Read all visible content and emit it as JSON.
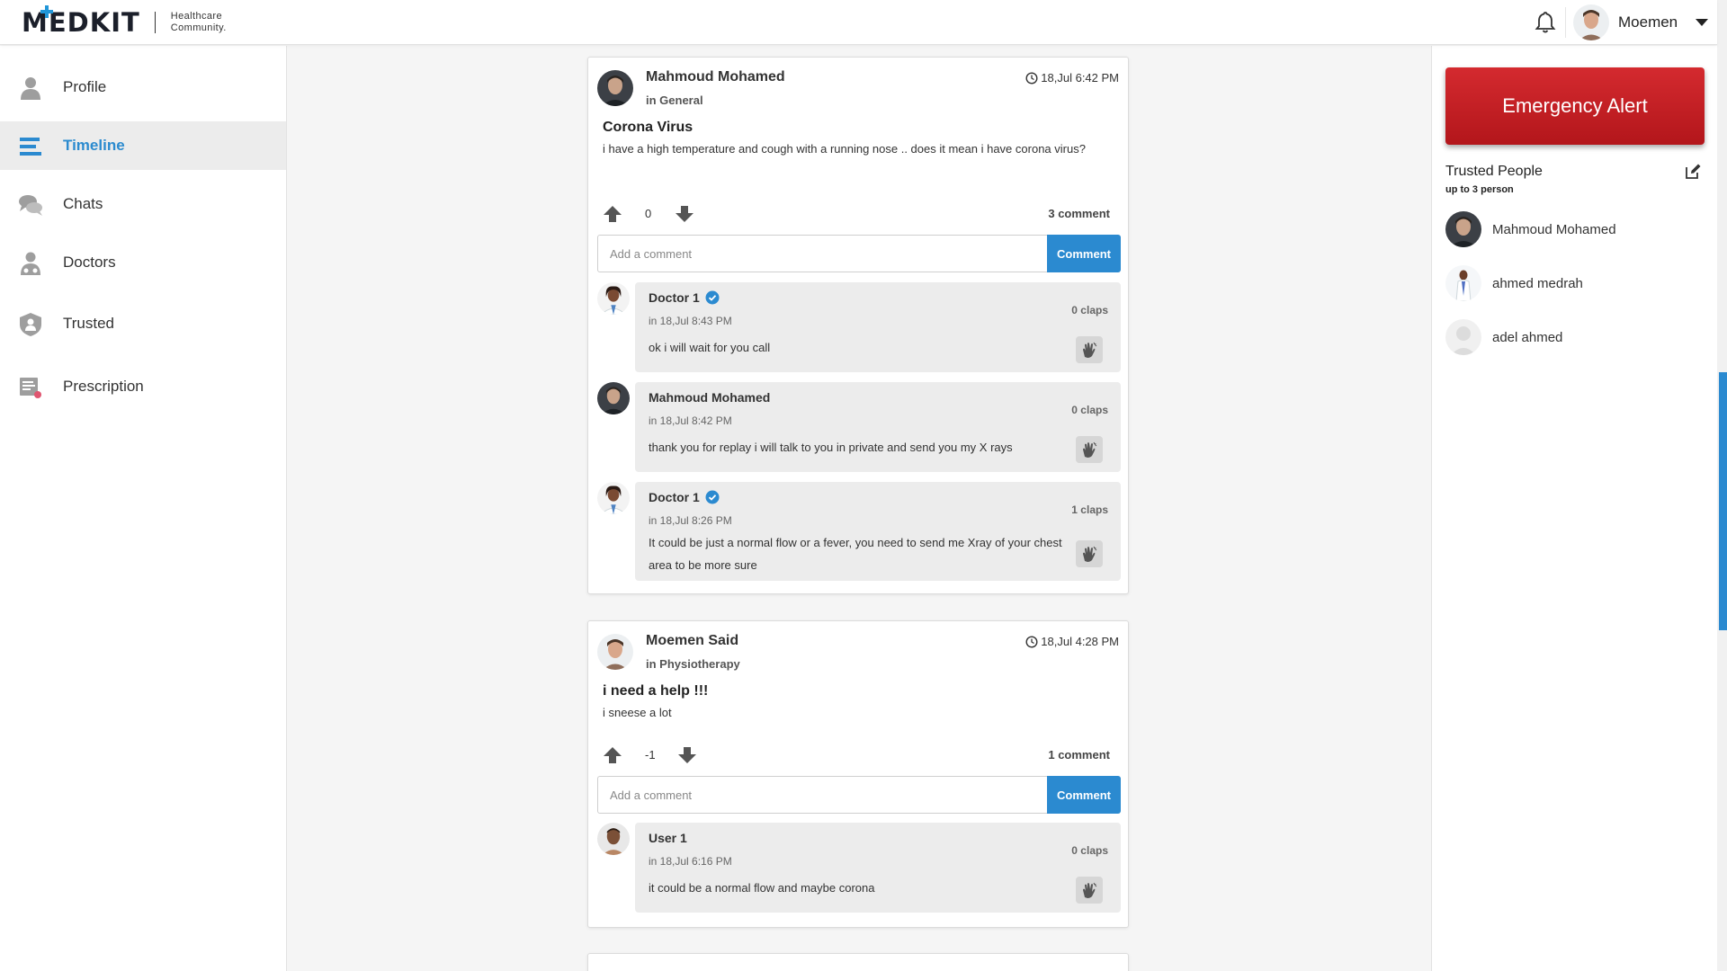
{
  "app": {
    "logo_text": "MEDKIT",
    "tagline_line1": "Healthcare",
    "tagline_line2": "Community."
  },
  "header": {
    "user_name": "Moemen"
  },
  "sidebar": {
    "items": [
      {
        "label": "Profile",
        "icon": "user-icon"
      },
      {
        "label": "Timeline",
        "icon": "timeline-icon",
        "active": true
      },
      {
        "label": "Chats",
        "icon": "chat-icon"
      },
      {
        "label": "Doctors",
        "icon": "doctor-icon"
      },
      {
        "label": "Trusted",
        "icon": "shield-icon"
      },
      {
        "label": "Prescription",
        "icon": "prescription-icon"
      }
    ]
  },
  "posts": [
    {
      "author": "Mahmoud Mohamed",
      "category": "in General",
      "time": "18,Jul 6:42 PM",
      "title": "Corona Virus",
      "body": "i have a high temperature and cough with a running nose .. does it mean i have corona virus?",
      "votes": "0",
      "comment_count": "3 comment",
      "comment_placeholder": "Add a comment",
      "comment_button": "Comment",
      "comments": [
        {
          "author": "Doctor 1",
          "verified": true,
          "date": "in 18,Jul 8:43 PM",
          "text": "ok i will wait for you call",
          "claps": "0 claps"
        },
        {
          "author": "Mahmoud Mohamed",
          "verified": false,
          "date": "in 18,Jul 8:42 PM",
          "text": "thank you for replay i will talk to you in private and send you my X rays",
          "claps": "0 claps"
        },
        {
          "author": "Doctor 1",
          "verified": true,
          "date": "in 18,Jul 8:26 PM",
          "text": "It could be just a normal flow or a fever, you need to send me Xray of your chest area to be more sure",
          "claps": "1 claps"
        }
      ]
    },
    {
      "author": "Moemen Said",
      "category": "in Physiotherapy",
      "time": "18,Jul 4:28 PM",
      "title": "i need a help !!!",
      "body": "i sneese a lot",
      "votes": "-1",
      "comment_count": "1 comment",
      "comment_placeholder": "Add a comment",
      "comment_button": "Comment",
      "comments": [
        {
          "author": "User 1",
          "verified": false,
          "date": "in 18,Jul 6:16 PM",
          "text": "it could be a normal flow and maybe corona",
          "claps": "0 claps"
        }
      ]
    }
  ],
  "right_panel": {
    "emergency_label": "Emergency Alert",
    "trusted_title": "Trusted People",
    "trusted_subtitle": "up to 3 person",
    "trusted_people": [
      {
        "name": "Mahmoud Mohamed"
      },
      {
        "name": "ahmed medrah"
      },
      {
        "name": "adel ahmed"
      }
    ]
  },
  "colors": {
    "accent": "#2b8ad0",
    "emergency": "#c41e23",
    "active_nav_bg": "#ececec"
  }
}
